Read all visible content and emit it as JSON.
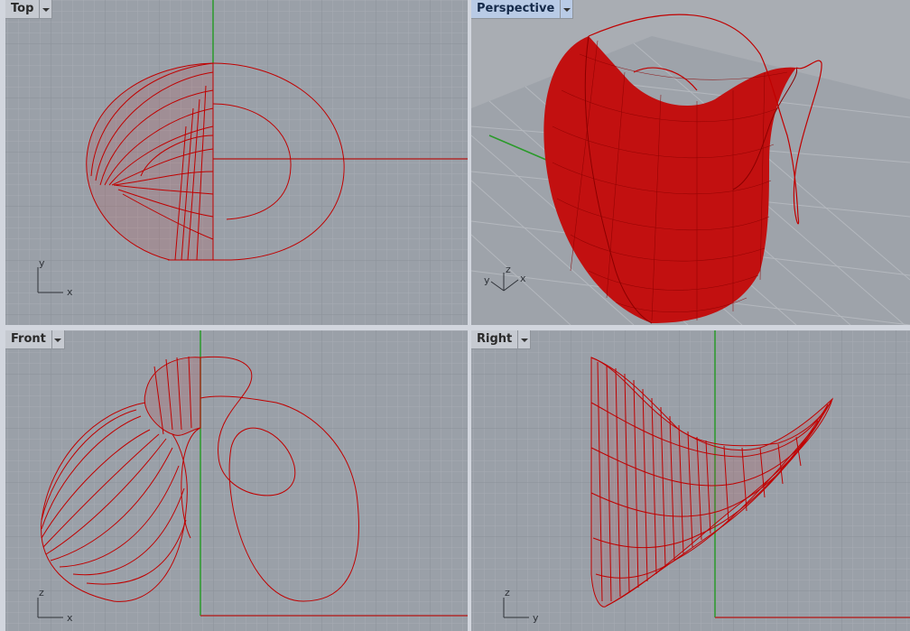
{
  "viewports": {
    "top": {
      "name": "Top",
      "axes": {
        "h": "x",
        "v": "y"
      },
      "active": false
    },
    "perspective": {
      "name": "Perspective",
      "axes": {
        "h": "x",
        "v": "y",
        "up": "z"
      },
      "active": true
    },
    "front": {
      "name": "Front",
      "axes": {
        "h": "x",
        "v": "z"
      },
      "active": false
    },
    "right": {
      "name": "Right",
      "axes": {
        "h": "y",
        "v": "z"
      },
      "active": false
    }
  },
  "colors": {
    "background": "#9aa0a8",
    "grid_minor": "#a6abb2",
    "grid_major": "#8a9098",
    "surface": "#c00000",
    "x_axis": "#b03030",
    "y_axis": "#2a9a2a"
  }
}
